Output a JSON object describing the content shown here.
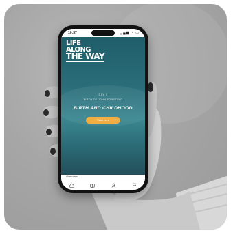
{
  "status_bar": {
    "time": "10:37",
    "icons": "▂▄▆ ◔ ▭"
  },
  "logo": {
    "line1": "LIFE ALONG",
    "line2": "THE WAY"
  },
  "lesson": {
    "day": "DAY 3",
    "subtitle": "BIRTH OF JOHN FORETOLD",
    "title": "BIRTH AND CHILDHOOD",
    "cta": "Read more"
  },
  "section_label": "Overview",
  "tabs": [
    {
      "icon": "home-icon"
    },
    {
      "icon": "book-icon"
    },
    {
      "icon": "profile-icon"
    },
    {
      "icon": "flag-icon"
    }
  ],
  "colors": {
    "brand_teal": "#2a6d79",
    "accent_orange": "#f0a93a"
  }
}
